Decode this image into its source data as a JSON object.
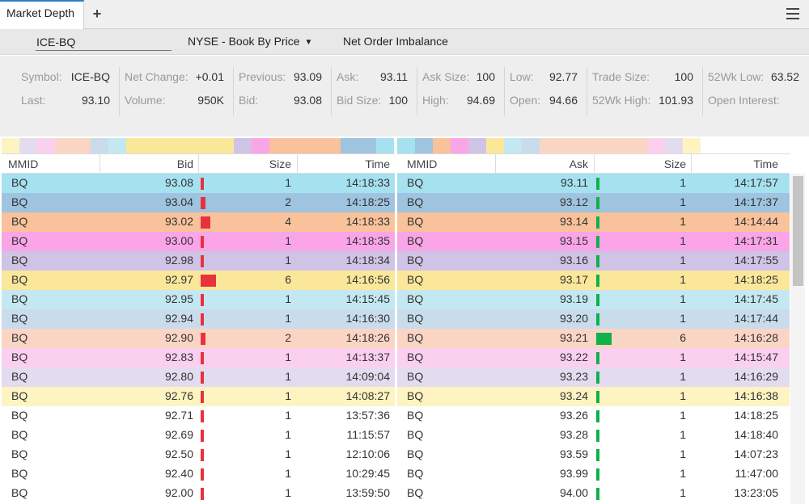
{
  "tab": {
    "title": "Market Depth",
    "add_label": "+"
  },
  "toolbar": {
    "symbol_value": "ICE-BQ",
    "book_select": "NYSE - Book By Price",
    "imbalance_label": "Net Order Imbalance"
  },
  "summary": {
    "symbol": {
      "label": "Symbol:",
      "value": "ICE-BQ"
    },
    "last": {
      "label": "Last:",
      "value": "93.10"
    },
    "net_change": {
      "label": "Net Change:",
      "value": "+0.01"
    },
    "volume": {
      "label": "Volume:",
      "value": "950K"
    },
    "previous": {
      "label": "Previous:",
      "value": "93.09"
    },
    "bid": {
      "label": "Bid:",
      "value": "93.08"
    },
    "ask": {
      "label": "Ask:",
      "value": "93.11"
    },
    "bid_size": {
      "label": "Bid Size:",
      "value": "100"
    },
    "ask_size": {
      "label": "Ask Size:",
      "value": "100"
    },
    "high": {
      "label": "High:",
      "value": "94.69"
    },
    "low": {
      "label": "Low:",
      "value": "92.77"
    },
    "open": {
      "label": "Open:",
      "value": "94.66"
    },
    "trade_size": {
      "label": "Trade Size:",
      "value": "100"
    },
    "wk52_high": {
      "label": "52Wk High:",
      "value": "101.93"
    },
    "wk52_low": {
      "label": "52Wk Low:",
      "value": "63.52"
    },
    "open_interest": {
      "label": "Open Interest:",
      "value": ""
    }
  },
  "colors": {
    "level_1": "#a6e1ef",
    "level_2": "#9fc4e0",
    "level_3": "#f9c29a",
    "level_4": "#f9a5e8",
    "level_5": "#cfc3e6",
    "level_6": "#fbe79a",
    "level_7": "#c4e8f1",
    "level_8": "#c8dcec",
    "level_9": "#fbd5c4",
    "level_10": "#fbd0ef",
    "level_11": "#e3dcf0",
    "level_12": "#fdf4c1",
    "bid_bar": "#e8323c",
    "ask_bar": "#0fb14a"
  },
  "bid_book": {
    "headers": {
      "mmid": "MMID",
      "price": "Bid",
      "size": "Size",
      "time": "Time"
    },
    "rows": [
      {
        "mmid": "BQ",
        "price": "93.08",
        "size": "1",
        "time": "14:18:33",
        "level": 1
      },
      {
        "mmid": "BQ",
        "price": "93.04",
        "size": "2",
        "time": "14:18:25",
        "level": 2
      },
      {
        "mmid": "BQ",
        "price": "93.02",
        "size": "4",
        "time": "14:18:33",
        "level": 3
      },
      {
        "mmid": "BQ",
        "price": "93.00",
        "size": "1",
        "time": "14:18:35",
        "level": 4
      },
      {
        "mmid": "BQ",
        "price": "92.98",
        "size": "1",
        "time": "14:18:34",
        "level": 5
      },
      {
        "mmid": "BQ",
        "price": "92.97",
        "size": "6",
        "time": "14:16:56",
        "level": 6
      },
      {
        "mmid": "BQ",
        "price": "92.95",
        "size": "1",
        "time": "14:15:45",
        "level": 7
      },
      {
        "mmid": "BQ",
        "price": "92.94",
        "size": "1",
        "time": "14:16:30",
        "level": 8
      },
      {
        "mmid": "BQ",
        "price": "92.90",
        "size": "2",
        "time": "14:18:26",
        "level": 9
      },
      {
        "mmid": "BQ",
        "price": "92.83",
        "size": "1",
        "time": "14:13:37",
        "level": 10
      },
      {
        "mmid": "BQ",
        "price": "92.80",
        "size": "1",
        "time": "14:09:04",
        "level": 11
      },
      {
        "mmid": "BQ",
        "price": "92.76",
        "size": "1",
        "time": "14:08:27",
        "level": 12
      },
      {
        "mmid": "BQ",
        "price": "92.71",
        "size": "1",
        "time": "13:57:36",
        "level": 0
      },
      {
        "mmid": "BQ",
        "price": "92.69",
        "size": "1",
        "time": "11:15:57",
        "level": 0
      },
      {
        "mmid": "BQ",
        "price": "92.50",
        "size": "1",
        "time": "12:10:06",
        "level": 0
      },
      {
        "mmid": "BQ",
        "price": "92.40",
        "size": "1",
        "time": "10:29:45",
        "level": 0
      },
      {
        "mmid": "BQ",
        "price": "92.00",
        "size": "1",
        "time": "13:59:50",
        "level": 0
      }
    ]
  },
  "ask_book": {
    "headers": {
      "mmid": "MMID",
      "price": "Ask",
      "size": "Size",
      "time": "Time"
    },
    "rows": [
      {
        "mmid": "BQ",
        "price": "93.11",
        "size": "1",
        "time": "14:17:57",
        "level": 1
      },
      {
        "mmid": "BQ",
        "price": "93.12",
        "size": "1",
        "time": "14:17:37",
        "level": 2
      },
      {
        "mmid": "BQ",
        "price": "93.14",
        "size": "1",
        "time": "14:14:44",
        "level": 3
      },
      {
        "mmid": "BQ",
        "price": "93.15",
        "size": "1",
        "time": "14:17:31",
        "level": 4
      },
      {
        "mmid": "BQ",
        "price": "93.16",
        "size": "1",
        "time": "14:17:55",
        "level": 5
      },
      {
        "mmid": "BQ",
        "price": "93.17",
        "size": "1",
        "time": "14:18:25",
        "level": 6
      },
      {
        "mmid": "BQ",
        "price": "93.19",
        "size": "1",
        "time": "14:17:45",
        "level": 7
      },
      {
        "mmid": "BQ",
        "price": "93.20",
        "size": "1",
        "time": "14:17:44",
        "level": 8
      },
      {
        "mmid": "BQ",
        "price": "93.21",
        "size": "6",
        "time": "14:16:28",
        "level": 9
      },
      {
        "mmid": "BQ",
        "price": "93.22",
        "size": "1",
        "time": "14:15:47",
        "level": 10
      },
      {
        "mmid": "BQ",
        "price": "93.23",
        "size": "1",
        "time": "14:16:29",
        "level": 11
      },
      {
        "mmid": "BQ",
        "price": "93.24",
        "size": "1",
        "time": "14:16:38",
        "level": 12
      },
      {
        "mmid": "BQ",
        "price": "93.26",
        "size": "1",
        "time": "14:18:25",
        "level": 0
      },
      {
        "mmid": "BQ",
        "price": "93.28",
        "size": "1",
        "time": "14:18:40",
        "level": 0
      },
      {
        "mmid": "BQ",
        "price": "93.59",
        "size": "1",
        "time": "14:07:23",
        "level": 0
      },
      {
        "mmid": "BQ",
        "price": "93.99",
        "size": "1",
        "time": "11:47:00",
        "level": 0
      },
      {
        "mmid": "BQ",
        "price": "94.00",
        "size": "1",
        "time": "13:23:05",
        "level": 0
      }
    ]
  },
  "strip_bid_levels": [
    12,
    11,
    10,
    9,
    8,
    7,
    6,
    5,
    4,
    3,
    2,
    1
  ],
  "strip_ask_levels": [
    1,
    2,
    3,
    4,
    5,
    6,
    7,
    8,
    9,
    10,
    11,
    12
  ],
  "strip_bid_counts": [
    1,
    1,
    1,
    2,
    1,
    1,
    6,
    1,
    1,
    4,
    2,
    1
  ],
  "strip_ask_counts": [
    1,
    1,
    1,
    1,
    1,
    1,
    1,
    1,
    6,
    1,
    1,
    1
  ]
}
